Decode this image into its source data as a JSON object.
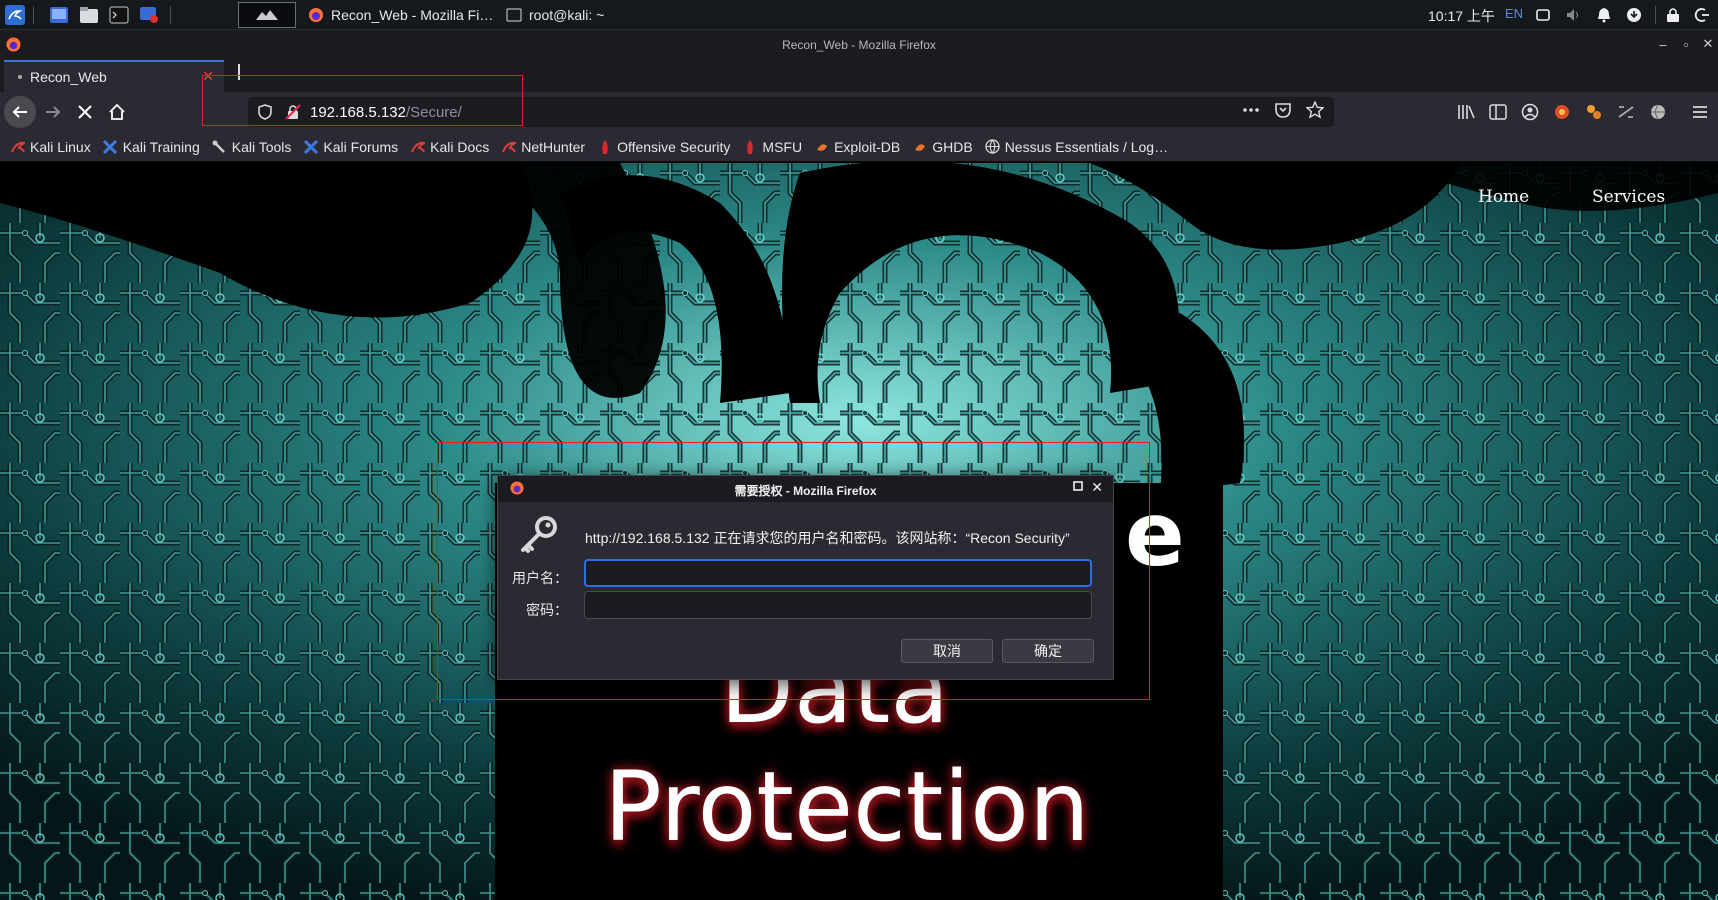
{
  "taskbar": {
    "tasks": [
      {
        "label": "Recon_Web - Mozilla Fi…"
      },
      {
        "label": "root@kali: ~"
      }
    ],
    "clock": "10:17 上午",
    "lang": "EN"
  },
  "window": {
    "title": "Recon_Web - Mozilla Firefox"
  },
  "tab": {
    "label": "Recon_Web"
  },
  "urlbar": {
    "host": "192.168.5.132",
    "path": "/Secure/"
  },
  "bookmarks": [
    {
      "label": "Kali Linux",
      "icon": "kali-dragon-icon"
    },
    {
      "label": "Kali Training",
      "icon": "kali-training-icon"
    },
    {
      "label": "Kali Tools",
      "icon": "kali-tools-icon"
    },
    {
      "label": "Kali Forums",
      "icon": "kali-forums-icon"
    },
    {
      "label": "Kali Docs",
      "icon": "kali-docs-icon"
    },
    {
      "label": "NetHunter",
      "icon": "nethunter-icon"
    },
    {
      "label": "Offensive Security",
      "icon": "offsec-icon"
    },
    {
      "label": "MSFU",
      "icon": "msfu-icon"
    },
    {
      "label": "Exploit-DB",
      "icon": "exploit-db-icon"
    },
    {
      "label": "GHDB",
      "icon": "ghdb-icon"
    },
    {
      "label": "Nessus Essentials / Log…",
      "icon": "globe-icon"
    }
  ],
  "site": {
    "nav": {
      "home": "Home",
      "services": "Services"
    },
    "hero_line1": "Data",
    "hero_line2": "Protection",
    "hero_fragment": "e"
  },
  "dialog": {
    "title": "需要授权 - Mozilla Firefox",
    "message": "http://192.168.5.132 正在请求您的用户名和密码。该网站称：“Recon Security”",
    "username_label": "用户名：",
    "password_label": "密码：",
    "username_value": "",
    "password_value": "",
    "cancel": "取消",
    "ok": "确定"
  },
  "colors": {
    "annotation": "#e02020",
    "accent": "#2a6ee8",
    "background": "#0a2a2c",
    "circuit": "#3fb9b4"
  }
}
